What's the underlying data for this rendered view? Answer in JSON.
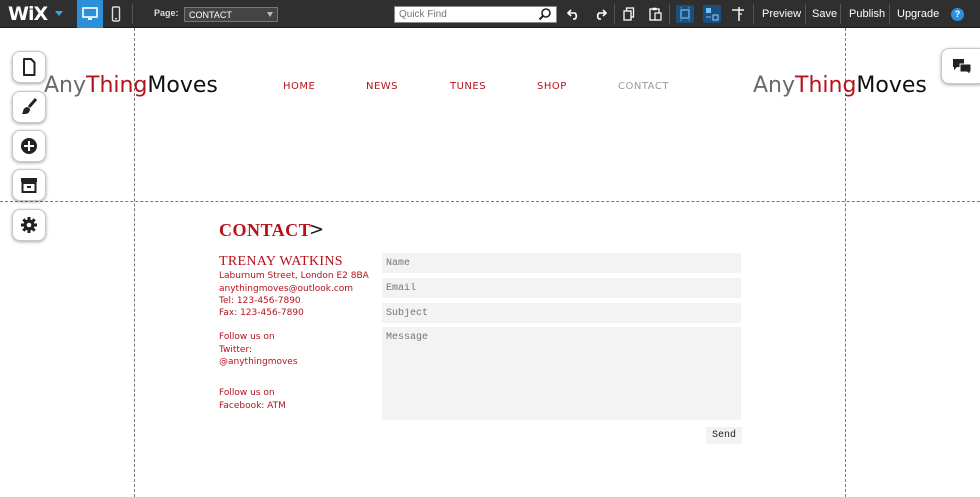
{
  "editor": {
    "brand": "WiX",
    "page_label": "Page:",
    "page_selected": "CONTACT",
    "quickfind_placeholder": "Quick Find",
    "preview": "Preview",
    "save": "Save",
    "publish": "Publish",
    "upgrade": "Upgrade",
    "help": "?",
    "accent_color": "#2b8fd9"
  },
  "site": {
    "logo": {
      "any": "Any",
      "thing": "Thing",
      "moves": "Moves"
    },
    "nav": [
      "HOME",
      "NEWS",
      "TUNES",
      "SHOP",
      "CONTACT"
    ],
    "brand_color": "#b5121b"
  },
  "contact": {
    "title": "CONTACT",
    "arrow": ">",
    "name": "TRENAY WATKINS",
    "address": "Laburnum Street, London E2 8BA",
    "email": "anythingmoves@outlook.com",
    "tel": "Tel: 123-456-7890",
    "fax": "Fax: 123-456-7890",
    "follow1": "Follow us on",
    "twitter_label": "Twitter:",
    "twitter_handle": "@anythingmoves",
    "follow2": "Follow us on",
    "facebook": "Facebook: ATM",
    "form": {
      "name_placeholder": "Name",
      "email_placeholder": "Email",
      "subject_placeholder": "Subject",
      "message_placeholder": "Message",
      "send": "Send"
    }
  }
}
